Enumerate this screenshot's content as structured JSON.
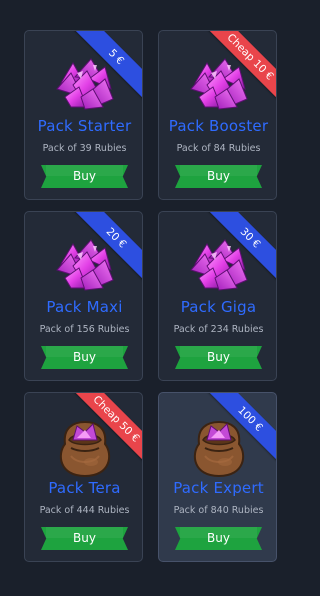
{
  "shop": {
    "packs": [
      {
        "name": "Pack Starter",
        "desc": "Pack of 39 Rubies",
        "badge": "5 €",
        "badge_color": "#2d4fe0",
        "icon": "rubies-icon",
        "buy": "Buy"
      },
      {
        "name": "Pack Booster",
        "desc": "Pack of 84 Rubies",
        "badge": "Cheap 10 €",
        "badge_color": "#e9454b",
        "icon": "rubies-icon",
        "buy": "Buy"
      },
      {
        "name": "Pack Maxi",
        "desc": "Pack of 156 Rubies",
        "badge": "20 €",
        "badge_color": "#2d4fe0",
        "icon": "rubies-icon",
        "buy": "Buy"
      },
      {
        "name": "Pack Giga",
        "desc": "Pack of 234 Rubies",
        "badge": "30 €",
        "badge_color": "#2d4fe0",
        "icon": "rubies-icon",
        "buy": "Buy"
      },
      {
        "name": "Pack Tera",
        "desc": "Pack of 444 Rubies",
        "badge": "Cheap 50 €",
        "badge_color": "#e9454b",
        "icon": "rubies-bag-icon",
        "buy": "Buy"
      },
      {
        "name": "Pack Expert",
        "desc": "Pack of 840 Rubies",
        "badge": "100 €",
        "badge_color": "#2d4fe0",
        "icon": "rubies-bag-icon",
        "buy": "Buy"
      }
    ]
  }
}
